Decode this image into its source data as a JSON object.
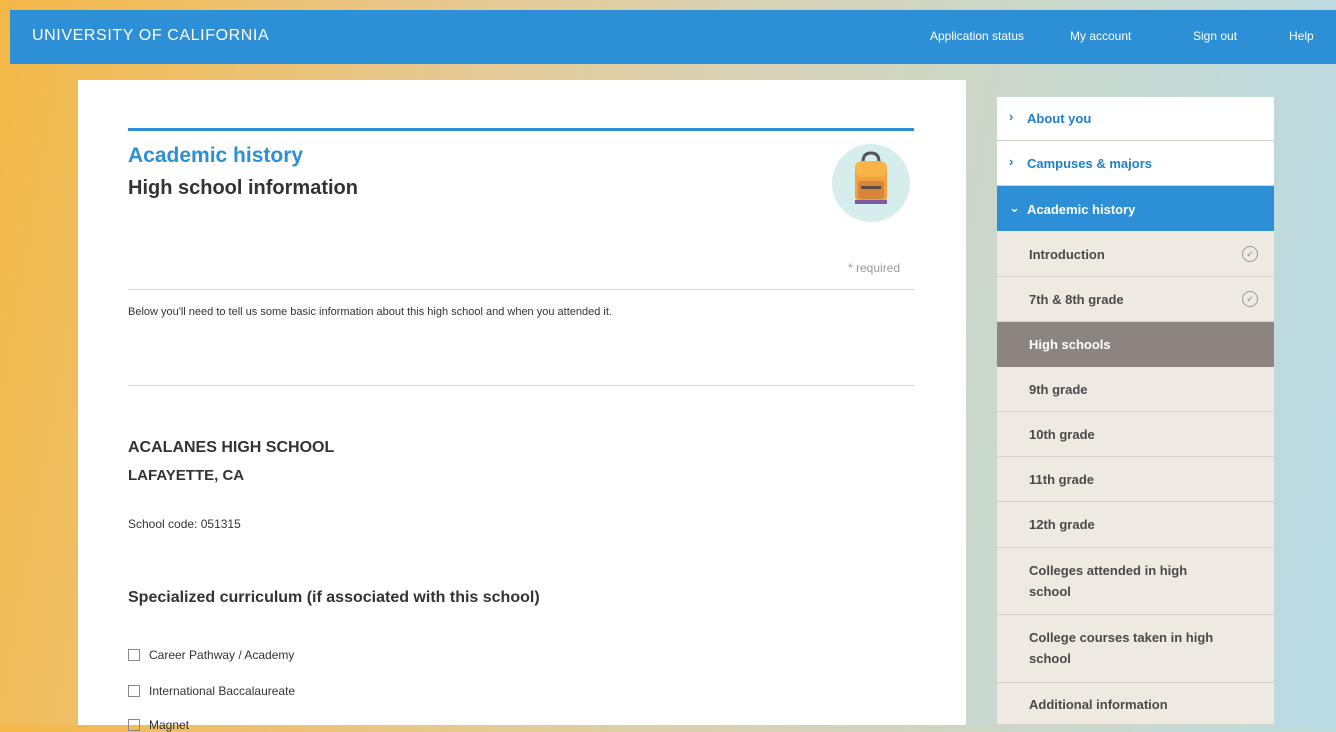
{
  "header": {
    "brand": "UNIVERSITY OF CALIFORNIA",
    "nav": [
      "Application status",
      "My account",
      "Sign out",
      "Help"
    ]
  },
  "page": {
    "section_title": "Academic history",
    "subtitle": "High school information",
    "badge_icon": "backpack-icon",
    "required_note": "* required",
    "intro_text": "Below you'll need to tell us some basic information about this high school and when you attended it.",
    "school": {
      "name": "ACALANES HIGH SCHOOL",
      "location": "LAFAYETTE, CA",
      "code_line": "School code: 051315"
    },
    "curriculum": {
      "heading": "Specialized curriculum (if associated with this school)",
      "options": [
        "Career Pathway / Academy",
        "International Baccalaureate",
        "Magnet"
      ]
    }
  },
  "sidebar": {
    "top_items": [
      "About you",
      "Campuses & majors"
    ],
    "active_item": "Academic history",
    "sub_items": [
      {
        "label": "Introduction",
        "completed": true
      },
      {
        "label": "7th & 8th grade",
        "completed": true
      },
      {
        "label": "High schools",
        "current": true
      },
      {
        "label": "9th grade"
      },
      {
        "label": "10th grade"
      },
      {
        "label": "11th grade"
      },
      {
        "label": "12th grade"
      },
      {
        "label": "Colleges attended in high school"
      },
      {
        "label": "College courses taken in high school"
      },
      {
        "label": "Additional information"
      }
    ]
  },
  "colors": {
    "brand_blue": "#2d8fd5",
    "current_item_bg": "#8c8480",
    "sub_item_bg": "#eee9e1"
  }
}
